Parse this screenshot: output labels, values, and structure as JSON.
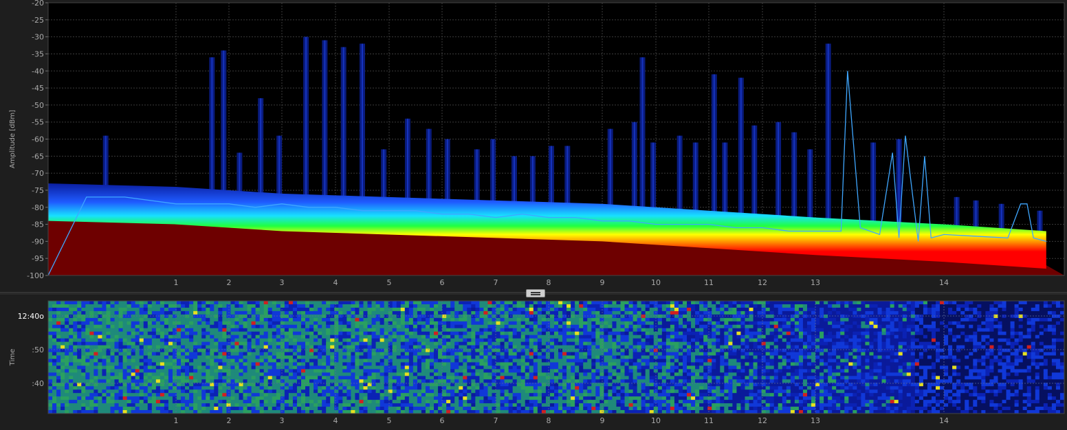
{
  "colors": {
    "background": "#000000",
    "panel": "#1e1e1e",
    "grid": "#3c3c3c",
    "axis_text": "#aaaaaa",
    "current_trace": "#3fa7ff",
    "peak_bars": "#0a1e8c",
    "floor_fill": "#6e0000"
  },
  "icons": {
    "splitter": "horizontal-grip-icon"
  },
  "chart_data": [
    {
      "type": "area",
      "name": "spectrum",
      "ylabel": "Amplitude [dBm]",
      "xlabel": "",
      "ylim": [
        -100,
        -20
      ],
      "y_ticks": [
        -20,
        -25,
        -30,
        -35,
        -40,
        -45,
        -50,
        -55,
        -60,
        -65,
        -70,
        -75,
        -80,
        -85,
        -90,
        -95,
        -100
      ],
      "x_ticks": [
        "1",
        "2",
        "3",
        "4",
        "5",
        "6",
        "7",
        "8",
        "9",
        "10",
        "11",
        "12",
        "13",
        "14"
      ],
      "grid": true,
      "noise_floor": {
        "x": [
          0,
          1,
          2,
          3,
          4,
          5,
          6,
          7,
          8,
          9,
          10,
          11,
          12,
          13,
          14,
          14.8
        ],
        "y": [
          -77,
          -78,
          -79,
          -80,
          -80.5,
          -81,
          -81.5,
          -82,
          -82.5,
          -83,
          -84,
          -85,
          -86,
          -87,
          -89,
          -91
        ]
      },
      "peak_bars": {
        "x": [
          0.45,
          1.68,
          1.9,
          2.2,
          2.6,
          2.95,
          3.45,
          3.8,
          4.15,
          4.5,
          4.9,
          5.35,
          5.75,
          6.1,
          6.65,
          6.95,
          7.35,
          7.7,
          8.05,
          8.35,
          9.15,
          9.6,
          9.75,
          9.95,
          10.45,
          10.75,
          11.1,
          11.3,
          11.6,
          11.85,
          12.3,
          12.6,
          12.9,
          13.1,
          13.45,
          13.65,
          14.1,
          14.25,
          14.45,
          14.75
        ],
        "y": [
          -59,
          -36,
          -34,
          -64,
          -48,
          -59,
          -30,
          -31,
          -33,
          -32,
          -63,
          -54,
          -57,
          -60,
          -63,
          -60,
          -65,
          -65,
          -62,
          -62,
          -57,
          -55,
          -36,
          -61,
          -59,
          -61,
          -41,
          -61,
          -42,
          -56,
          -55,
          -58,
          -63,
          -32,
          -61,
          -60,
          -77,
          -78,
          -79,
          -81
        ]
      },
      "current_trace": {
        "x": [
          0,
          0.3,
          0.6,
          1,
          1.5,
          2,
          2.5,
          3,
          3.5,
          4,
          4.5,
          5,
          5.5,
          6,
          6.5,
          7,
          7.5,
          8,
          8.5,
          9,
          9.5,
          10,
          10.5,
          11,
          11.5,
          12,
          12.5,
          13,
          13.2,
          13.25,
          13.35,
          13.5,
          13.6,
          13.65,
          13.7,
          13.8,
          13.85,
          13.9,
          14,
          14.5,
          14.6,
          14.65,
          14.7,
          14.8
        ],
        "y": [
          -100,
          -77,
          -77,
          -79,
          -79,
          -79,
          -80,
          -79,
          -80,
          -80,
          -81,
          -81,
          -81,
          -82,
          -82,
          -83,
          -82,
          -83,
          -83,
          -84,
          -84,
          -85,
          -85,
          -85,
          -86,
          -86,
          -87,
          -87,
          -87,
          -40,
          -86,
          -88,
          -64,
          -89,
          -59,
          -90,
          -65,
          -89,
          -88,
          -89,
          -79,
          -79,
          -89,
          -90
        ]
      }
    },
    {
      "type": "heatmap",
      "name": "spectrogram",
      "ylabel": "Time",
      "x_ticks": [
        "1",
        "2",
        "3",
        "4",
        "5",
        "6",
        "7",
        "8",
        "9",
        "10",
        "11",
        "12",
        "13",
        "14"
      ],
      "y_ticks": [
        "12:40o",
        ":50",
        ":40"
      ],
      "grid": true
    }
  ]
}
